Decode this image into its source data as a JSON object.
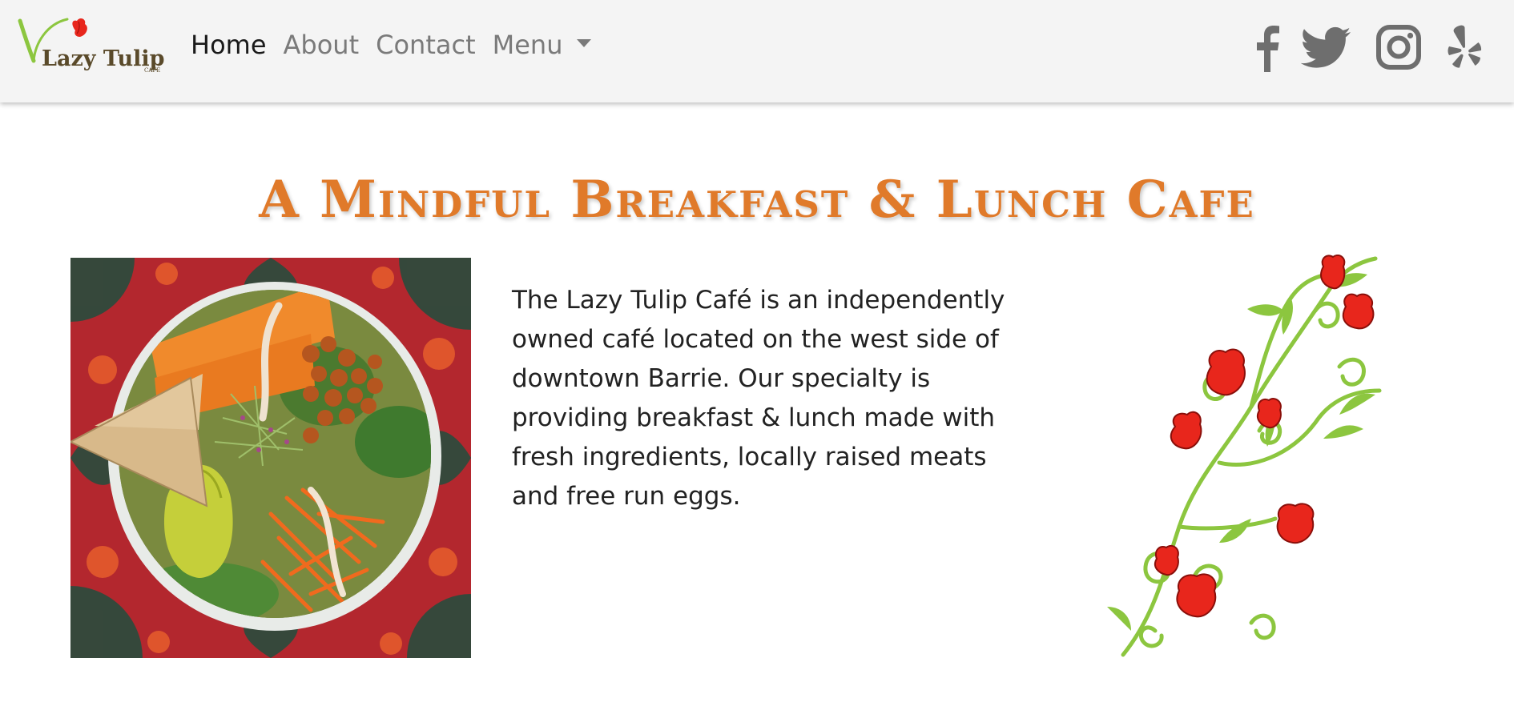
{
  "logo": {
    "word": "Lazy Tulip",
    "sub": "CAFÉ"
  },
  "nav": {
    "items": [
      {
        "label": "Home",
        "active": true
      },
      {
        "label": "About"
      },
      {
        "label": "Contact"
      },
      {
        "label": "Menu",
        "dropdown": true
      }
    ]
  },
  "social_icons": [
    "facebook-icon",
    "twitter-icon",
    "instagram-icon",
    "yelp-icon"
  ],
  "headline": "A Mindful Breakfast & Lunch Cafe",
  "intro_text": "The Lazy Tulip Café is an independently owned café located on the west side of downtown Barrie. Our specialty is providing breakfast & lunch made with fresh ingredients, locally raised meats and free run eggs.",
  "colors": {
    "accent": "#e07a2a",
    "nav_bg": "#f4f4f4",
    "nav_text": "#7a7a7a",
    "nav_active": "#1a1a1a",
    "tulip_red": "#e8261c",
    "leaf_green": "#8cc63f"
  }
}
